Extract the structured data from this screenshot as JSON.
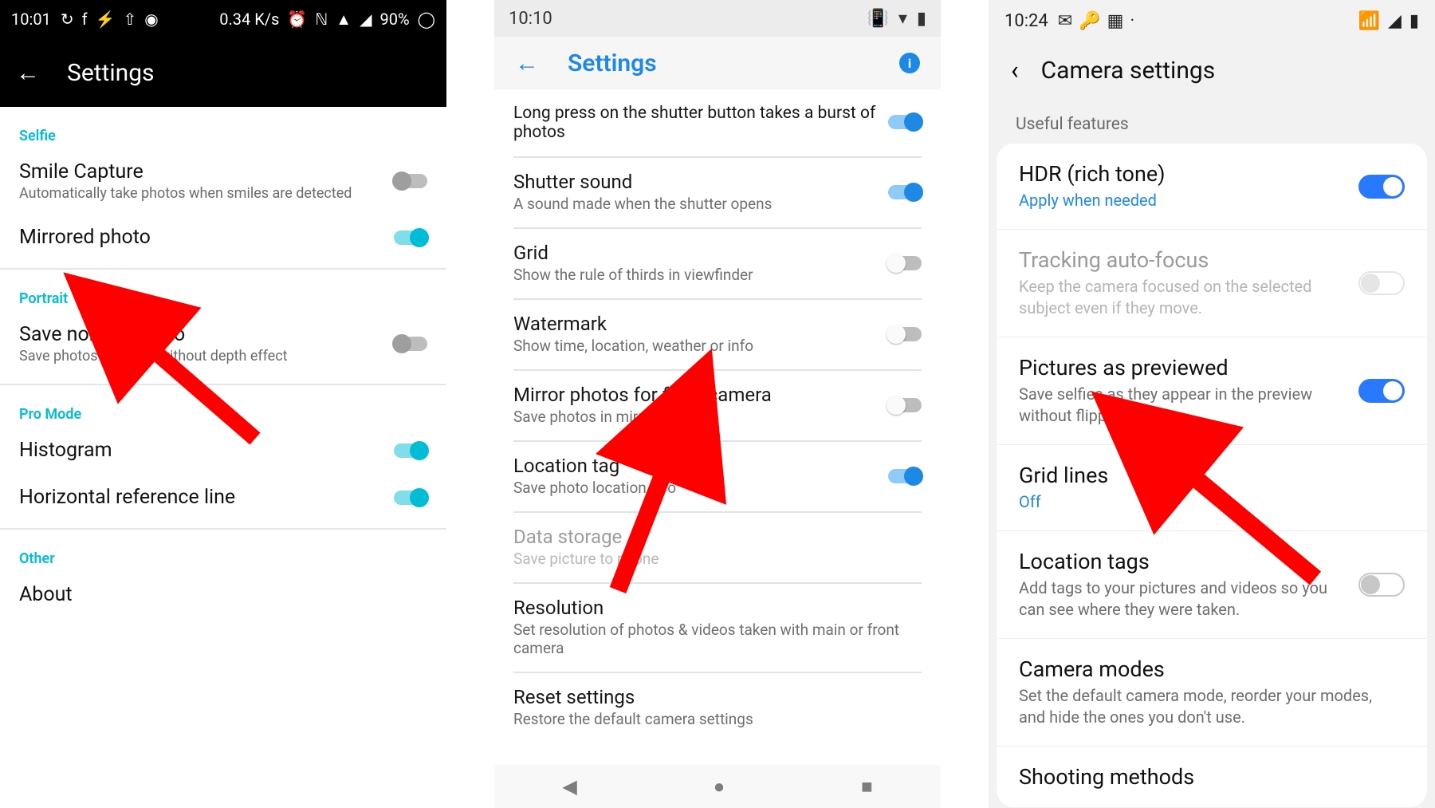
{
  "p1": {
    "status": {
      "time": "10:01",
      "netrate": "0.34 K/s",
      "battery": "90%"
    },
    "header_title": "Settings",
    "sections": {
      "selfie": {
        "label": "Selfie",
        "smile_title": "Smile Capture",
        "smile_sub": "Automatically take photos when smiles are detected",
        "mirror_title": "Mirrored photo"
      },
      "portrait": {
        "label": "Portrait",
        "save_title": "Save normal photo",
        "save_sub": "Save photos with and without depth effect"
      },
      "promode": {
        "label": "Pro Mode",
        "hist_title": "Histogram",
        "horiz_title": "Horizontal reference line"
      },
      "other": {
        "label": "Other",
        "about_title": "About"
      }
    }
  },
  "p2": {
    "status": {
      "time": "10:10"
    },
    "header_title": "Settings",
    "items": {
      "burst_sub": "Long press on the shutter button takes a burst of photos",
      "shutter_title": "Shutter sound",
      "shutter_sub": "A sound made when the shutter opens",
      "grid_title": "Grid",
      "grid_sub": "Show the rule of thirds in viewfinder",
      "watermark_title": "Watermark",
      "watermark_sub": "Show time, location, weather or info",
      "mirror_title": "Mirror photos for front camera",
      "mirror_sub": "Save photos in mirror mode",
      "loc_title": "Location tag",
      "loc_sub": "Save photo location info",
      "storage_title": "Data storage",
      "storage_sub": "Save picture to phone",
      "res_title": "Resolution",
      "res_sub": "Set resolution of photos & videos taken with main or front camera",
      "reset_title": "Reset settings",
      "reset_sub": "Restore the default camera settings"
    }
  },
  "p3": {
    "status": {
      "time": "10:24"
    },
    "header_title": "Camera settings",
    "section_label": "Useful features",
    "rows": {
      "hdr_title": "HDR (rich tone)",
      "hdr_sub": "Apply when needed",
      "track_title": "Tracking auto-focus",
      "track_sub": "Keep the camera focused on the selected subject even if they move.",
      "preview_title": "Pictures as previewed",
      "preview_sub": "Save selfies as they appear in the preview without flipping them.",
      "grid_title": "Grid lines",
      "grid_sub": "Off",
      "loc_title": "Location tags",
      "loc_sub": "Add tags to your pictures and videos so you can see where they were taken.",
      "modes_title": "Camera modes",
      "modes_sub": "Set the default camera mode, reorder your modes, and hide the ones you don't use.",
      "shoot_title": "Shooting methods"
    }
  }
}
